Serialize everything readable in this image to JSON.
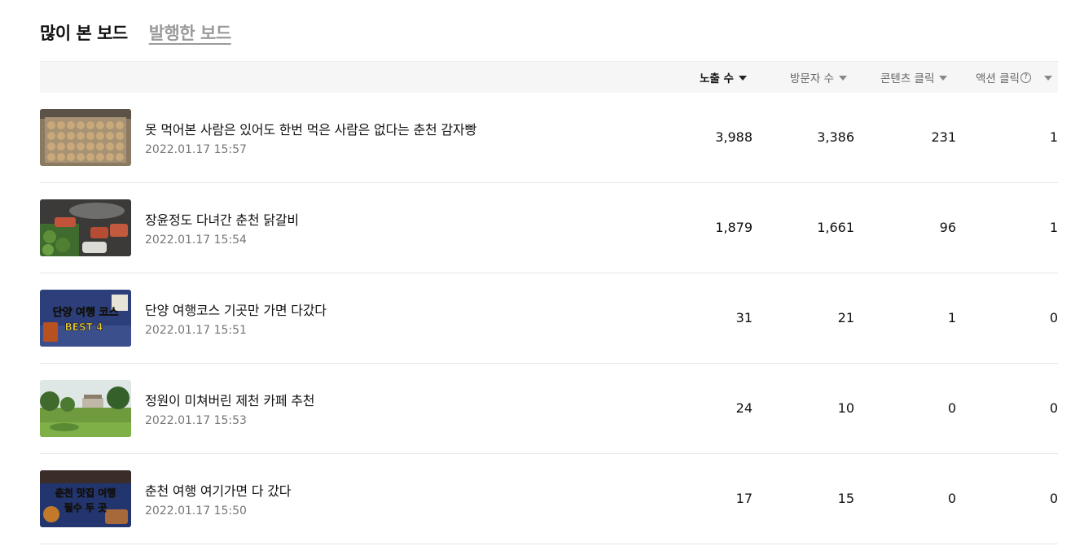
{
  "tabs": [
    {
      "label": "많이 본 보드",
      "active": true
    },
    {
      "label": "발행한 보드",
      "active": false
    }
  ],
  "columns": {
    "impressions": "노출 수",
    "visitors": "방문자 수",
    "content_clicks": "콘텐츠 클릭",
    "action_clicks": "액션 클릭",
    "help_icon_glyph": "?"
  },
  "rows": [
    {
      "title": "못 먹어본 사람은 있어도 한번 먹은 사람은 없다는 춘천 감자빵",
      "date": "2022.01.17 15:57",
      "impressions": "3,988",
      "visitors": "3,386",
      "content_clicks": "231",
      "action_clicks": "1"
    },
    {
      "title": "장윤정도 다녀간 춘천 닭갈비",
      "date": "2022.01.17 15:54",
      "impressions": "1,879",
      "visitors": "1,661",
      "content_clicks": "96",
      "action_clicks": "1"
    },
    {
      "title": "단양 여행코스 기곳만 가면 다갔다",
      "date": "2022.01.17 15:51",
      "impressions": "31",
      "visitors": "21",
      "content_clicks": "1",
      "action_clicks": "0",
      "thumb_text": [
        "단양 여행 코스",
        "BEST 4"
      ]
    },
    {
      "title": "정원이 미쳐버린 제천 카페 추천",
      "date": "2022.01.17 15:53",
      "impressions": "24",
      "visitors": "10",
      "content_clicks": "0",
      "action_clicks": "0"
    },
    {
      "title": "춘천 여행 여기가면 다 갔다",
      "date": "2022.01.17 15:50",
      "impressions": "17",
      "visitors": "15",
      "content_clicks": "0",
      "action_clicks": "0",
      "thumb_text": [
        "춘천 맛집 여행",
        "필수 두 곳"
      ]
    }
  ],
  "colors": {
    "header_bg": "#f6f6f6",
    "divider": "#e6e6e6",
    "muted": "#777777"
  }
}
